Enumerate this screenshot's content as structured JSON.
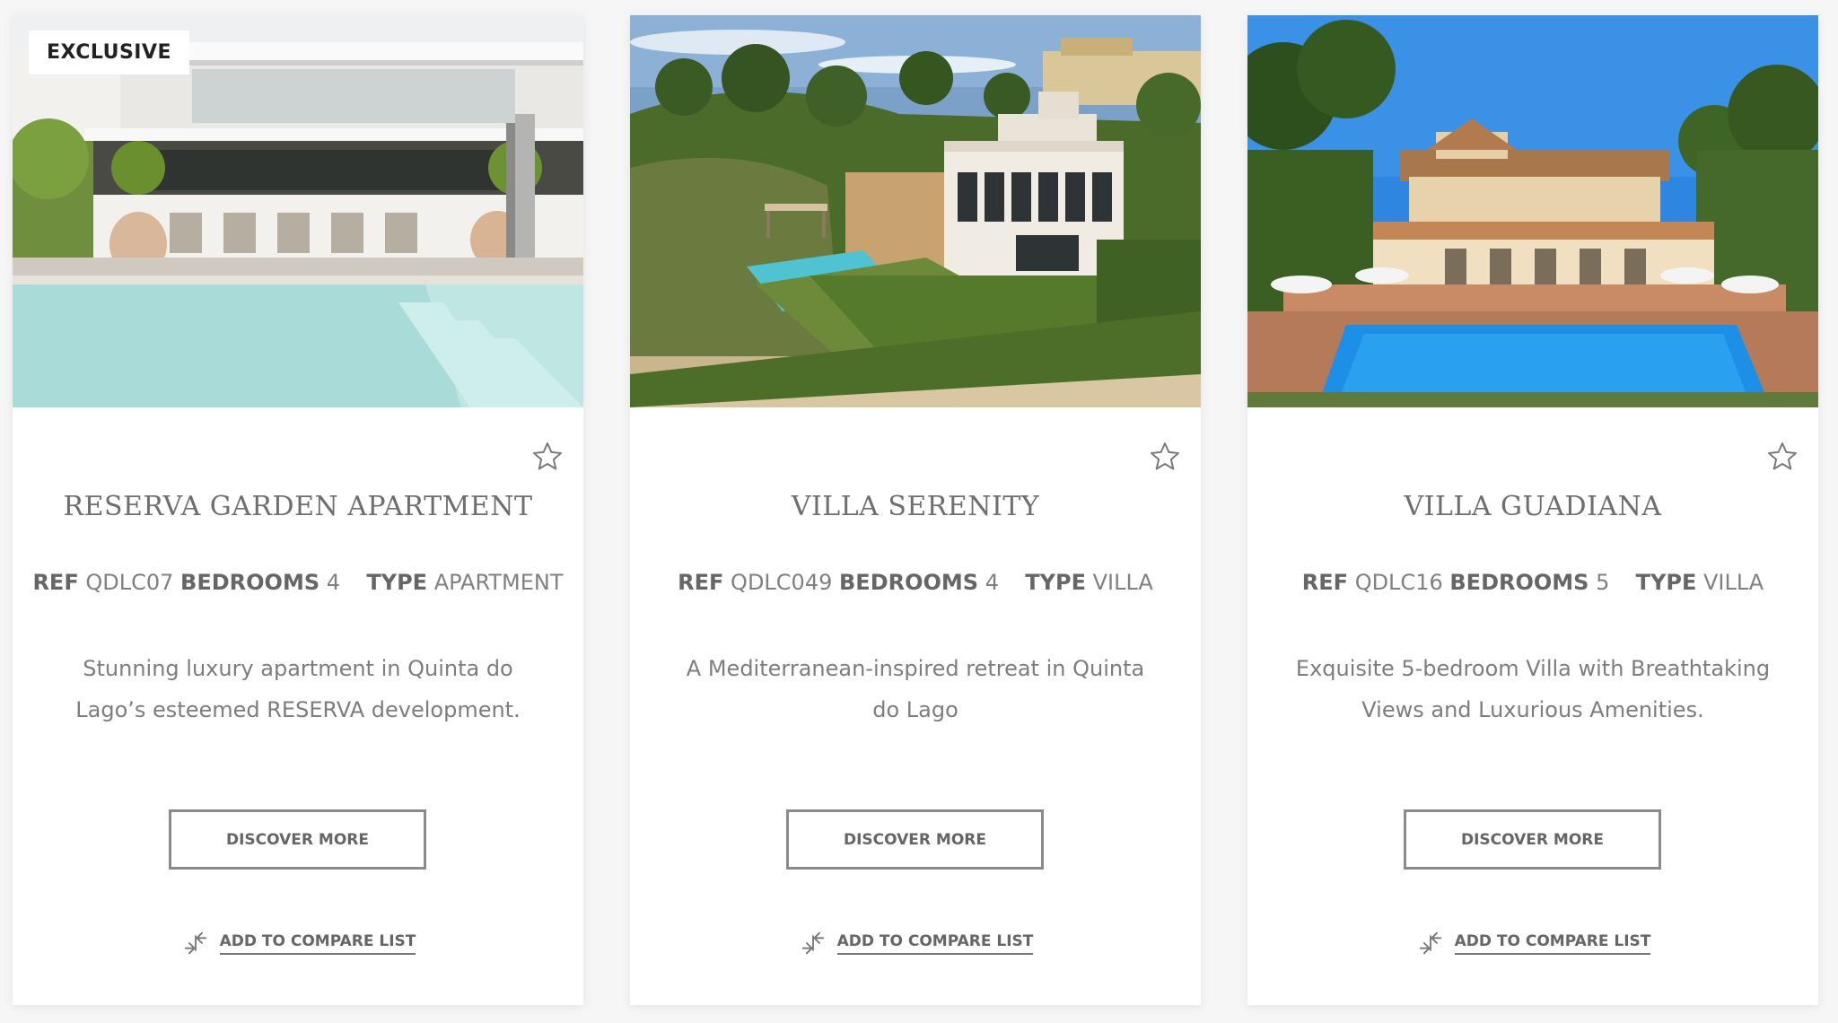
{
  "cards": [
    {
      "badge": "EXCLUSIVE",
      "photo": "pool-terrace-photo",
      "title": "RESERVA GARDEN APARTMENT",
      "ref_label": "REF",
      "ref": "QDLC07",
      "bedrooms_label": "BEDROOMS",
      "bedrooms": "4",
      "type_label": "TYPE",
      "type": "APARTMENT",
      "description": "Stunning luxury apartment in Quinta do Lago’s esteemed RESERVA development.",
      "button": "DISCOVER MORE",
      "compare": "ADD TO COMPARE LIST"
    },
    {
      "photo": "villa-hillside-photo",
      "title": "VILLA SERENITY",
      "ref_label": "REF",
      "ref": "QDLC049",
      "bedrooms_label": "BEDROOMS",
      "bedrooms": "4",
      "type_label": "TYPE",
      "type": "VILLA",
      "description": "A Mediterranean-inspired retreat in Quinta do Lago",
      "button": "DISCOVER MORE",
      "compare": "ADD TO COMPARE LIST"
    },
    {
      "photo": "villa-pool-photo",
      "title": "VILLA GUADIANA",
      "ref_label": "REF",
      "ref": "QDLC16",
      "bedrooms_label": "BEDROOMS",
      "bedrooms": "5",
      "type_label": "TYPE",
      "type": "VILLA",
      "description": "Exquisite 5-bedroom Villa with Breathtaking Views and Luxurious Amenities.",
      "button": "DISCOVER MORE",
      "compare": "ADD TO COMPARE LIST"
    }
  ],
  "icons": {
    "favorite": "star-outline-icon",
    "compare": "compare-arrows-icon"
  },
  "colors": {
    "text": "#7d7d7d",
    "border": "#8a8a8a",
    "card": "#ffffff",
    "background": "#f6f6f6"
  }
}
